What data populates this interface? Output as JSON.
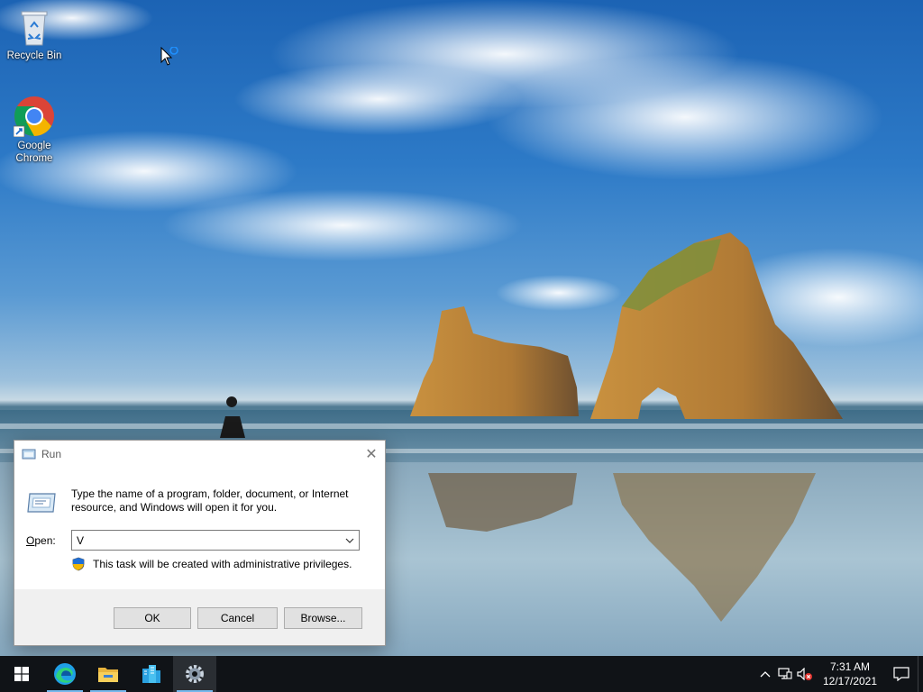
{
  "desktop": {
    "icons": [
      {
        "label": "Recycle Bin",
        "icon": "recycle-bin-icon"
      },
      {
        "label": "Google Chrome",
        "icon": "chrome-icon"
      }
    ]
  },
  "run_dialog": {
    "title": "Run",
    "description": "Type the name of a program, folder, document, or Internet resource, and Windows will open it for you.",
    "open_label_prefix": "O",
    "open_label_rest": "pen:",
    "open_value": "V",
    "admin_note": "This task will be created with administrative privileges.",
    "buttons": {
      "ok": "OK",
      "cancel": "Cancel",
      "browse": "Browse..."
    }
  },
  "taskbar": {
    "apps": [
      {
        "name": "Start",
        "icon": "windows-start-icon"
      },
      {
        "name": "Microsoft Edge",
        "icon": "edge-icon"
      },
      {
        "name": "File Explorer",
        "icon": "file-explorer-icon"
      },
      {
        "name": "Office",
        "icon": "office-icon"
      },
      {
        "name": "Settings",
        "icon": "settings-gear-icon"
      }
    ],
    "clock": {
      "time": "7:31 AM",
      "date": "12/17/2021"
    }
  },
  "colors": {
    "taskbar": "#101317",
    "accent": "#76b9ed",
    "sky": "#2d7ac7"
  }
}
